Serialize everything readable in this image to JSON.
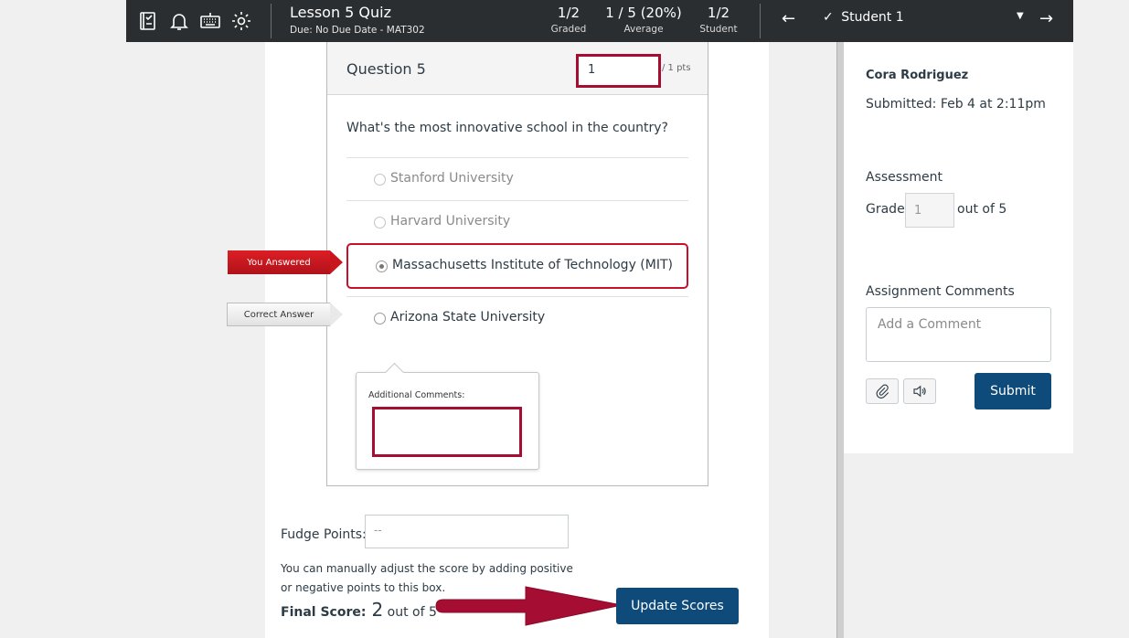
{
  "topbar": {
    "title": "Lesson 5 Quiz",
    "due": "Due: No Due Date - MAT302",
    "stats": [
      {
        "value": "1/2",
        "label": "Graded"
      },
      {
        "value": "1 / 5 (20%)",
        "label": "Average"
      },
      {
        "value": "1/2",
        "label": "Student"
      }
    ],
    "prev_arrow": "←",
    "next_arrow": "→",
    "student_select": "Student 1",
    "check_glyph": "✓",
    "caret_glyph": "▼",
    "icons": [
      "gradebook-icon",
      "bell-icon",
      "keyboard-icon",
      "gear-icon"
    ]
  },
  "question": {
    "title": "Question 5",
    "points_value": "1",
    "points_label": "/ 1 pts",
    "text": "What's the most innovative school in the country?",
    "answers": [
      {
        "label": "Stanford University"
      },
      {
        "label": "Harvard University"
      },
      {
        "label": "Massachusetts Institute of Technology (MIT)"
      },
      {
        "label": "Arizona State University"
      }
    ],
    "you_answered_tag": "You Answered",
    "correct_answer_tag": "Correct Answer",
    "additional_comments_label": "Additional Comments:"
  },
  "fudge": {
    "label": "Fudge Points:",
    "placeholder": "--",
    "help": "You can manually adjust the score by adding positive or negative points to this box.",
    "final_label": "Final Score:",
    "final_value": "2",
    "final_out_of": "out of 5",
    "update_button": "Update Scores"
  },
  "right": {
    "student_name": "Cora Rodriguez",
    "submitted": "Submitted: Feb 4 at 2:11pm",
    "assessment_heading": "Assessment",
    "grade_label": "Grade",
    "grade_value": "1",
    "grade_out_of": "out of 5",
    "comments_heading": "Assignment Comments",
    "comment_placeholder": "Add a Comment",
    "submit_button": "Submit"
  },
  "colors": {
    "topbar_bg": "#2b2e31",
    "accent_red": "#a50d32",
    "primary_blue": "#0e4a7a"
  }
}
